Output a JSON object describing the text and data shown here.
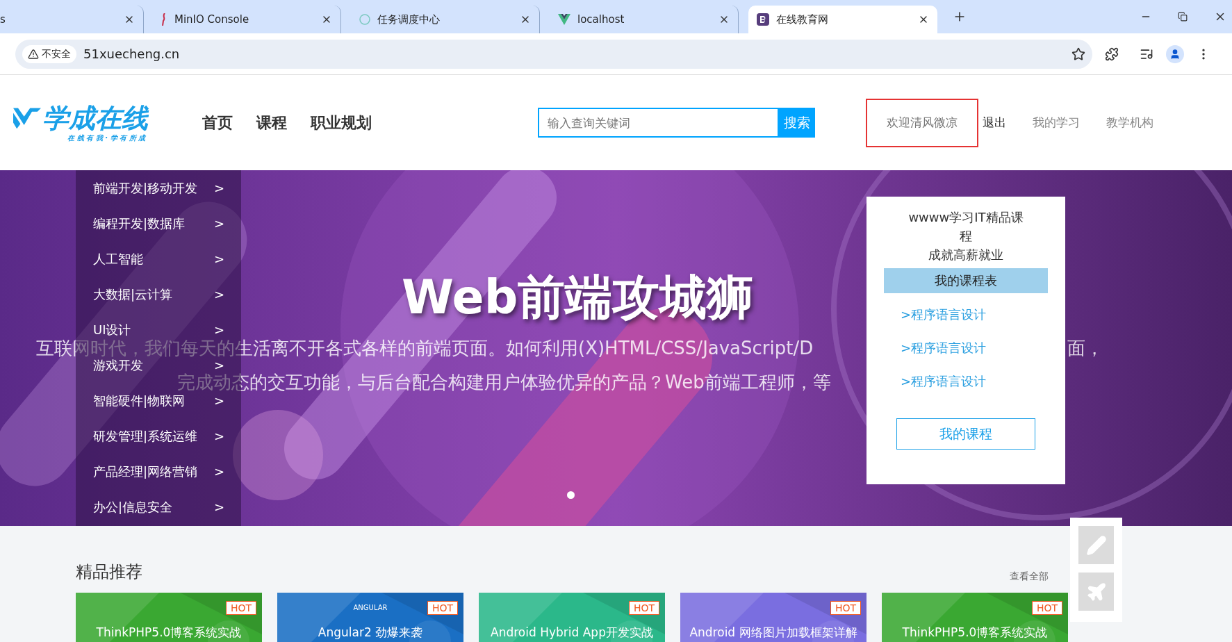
{
  "browser": {
    "tabs": [
      {
        "title": "s",
        "selected": false
      },
      {
        "title": "MinIO Console",
        "selected": false
      },
      {
        "title": "任务调度中心",
        "selected": false
      },
      {
        "title": "localhost",
        "selected": false
      },
      {
        "title": "在线教育网",
        "selected": true
      }
    ],
    "security": "不安全",
    "url": "51xuecheng.cn"
  },
  "header": {
    "logo": {
      "name": "学成在线",
      "slogan": "在 线 有 我 · 学 有 所 成"
    },
    "nav": [
      "首页",
      "课程",
      "职业规划"
    ],
    "search": {
      "placeholder": "输入查询关键词",
      "button": "搜索"
    },
    "welcome": "欢迎清风微凉",
    "user_links": [
      {
        "label": "退出",
        "kind": "dark"
      },
      {
        "label": "我的学习",
        "kind": "muted"
      },
      {
        "label": "教学机构",
        "kind": "muted"
      }
    ]
  },
  "banner": {
    "categories": [
      "前端开发|移动开发",
      "编程开发|数据库",
      "人工智能",
      "大数据|云计算",
      "UI设计",
      "游戏开发",
      "智能硬件|物联网",
      "研发管理|系统运维",
      "产品经理|网络营销",
      "办公|信息安全"
    ],
    "arrow": ">",
    "headline": "Web前端攻城狮",
    "line_1": "互联网时代，我们每天的生活离不开各式各样的前端页面。如何利用(X)HTML/CSS/JavaScript/D",
    "line_1_tail": "面，",
    "line_2": "完成动态的交互功能，与后台配合构建用户体验优异的产品？Web前端工程师，等",
    "dots": [
      {
        "selected": true
      }
    ],
    "card": {
      "title": "wwww学习IT精品课程",
      "subtitle": "成就高薪就业",
      "schedule": "我的课程表",
      "links": [
        ">程序语言设计",
        ">程序语言设计",
        ">程序语言设计"
      ],
      "button": "我的课程"
    }
  },
  "recommend": {
    "title": "精品推荐",
    "more": "查看全部",
    "courses": [
      {
        "title": "ThinkPHP5.0博客系统实战",
        "badge": "HOT",
        "color": "#3aa832"
      },
      {
        "title": "Angular2 劲爆来袭",
        "badge": "HOT",
        "color": "#1a6fc4",
        "logo": "ANGULAR"
      },
      {
        "title": "Android Hybrid App开发实战",
        "badge": "HOT",
        "color": "#2bb88a"
      },
      {
        "title": "Android 网络图片加载框架详解",
        "badge": "HOT",
        "color": "#7a6ee0"
      },
      {
        "title": "ThinkPHP5.0博客系统实战",
        "badge": "HOT",
        "color": "#3aa832"
      }
    ]
  }
}
